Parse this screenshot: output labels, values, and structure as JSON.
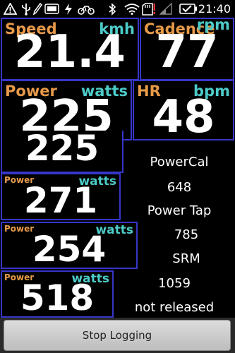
{
  "status_bar": {
    "time": "21:40",
    "icons": [
      "usb-warning-icon",
      "usb-icon",
      "pencil-icon",
      "battery-small-icon",
      "flash-icon",
      "bicycle-icon",
      "bluetooth-icon",
      "wifi-icon",
      "sd-card-alert-icon",
      "signal-icon",
      "battery-icon"
    ]
  },
  "main": {
    "speed": {
      "label": "Speed",
      "unit": "kmh",
      "value": "21.4"
    },
    "cadence": {
      "label": "Cadence",
      "unit": "rpm",
      "value": "77"
    },
    "power": {
      "label": "Power",
      "unit": "watts",
      "value": "225"
    },
    "hr": {
      "label": "HR",
      "unit": "bpm",
      "value": "48"
    }
  },
  "sensors": [
    {
      "value_partial": "225",
      "info_value": "",
      "info_name": "PowerCal"
    },
    {
      "label": "Power",
      "unit": "watts",
      "value": "271",
      "info_value": "648",
      "info_name": "Power Tap"
    },
    {
      "label": "Power",
      "unit": "watts",
      "value": "254",
      "info_value": "785",
      "info_name": "SRM"
    },
    {
      "label": "Power",
      "unit": "watts",
      "value": "518",
      "info_value": "1059",
      "info_name": "not released"
    }
  ],
  "button": {
    "label": "Stop Logging"
  },
  "colors": {
    "label": "#e79a49",
    "unit": "#4ccbc8",
    "border": "#3636c8",
    "background": "#000000"
  }
}
